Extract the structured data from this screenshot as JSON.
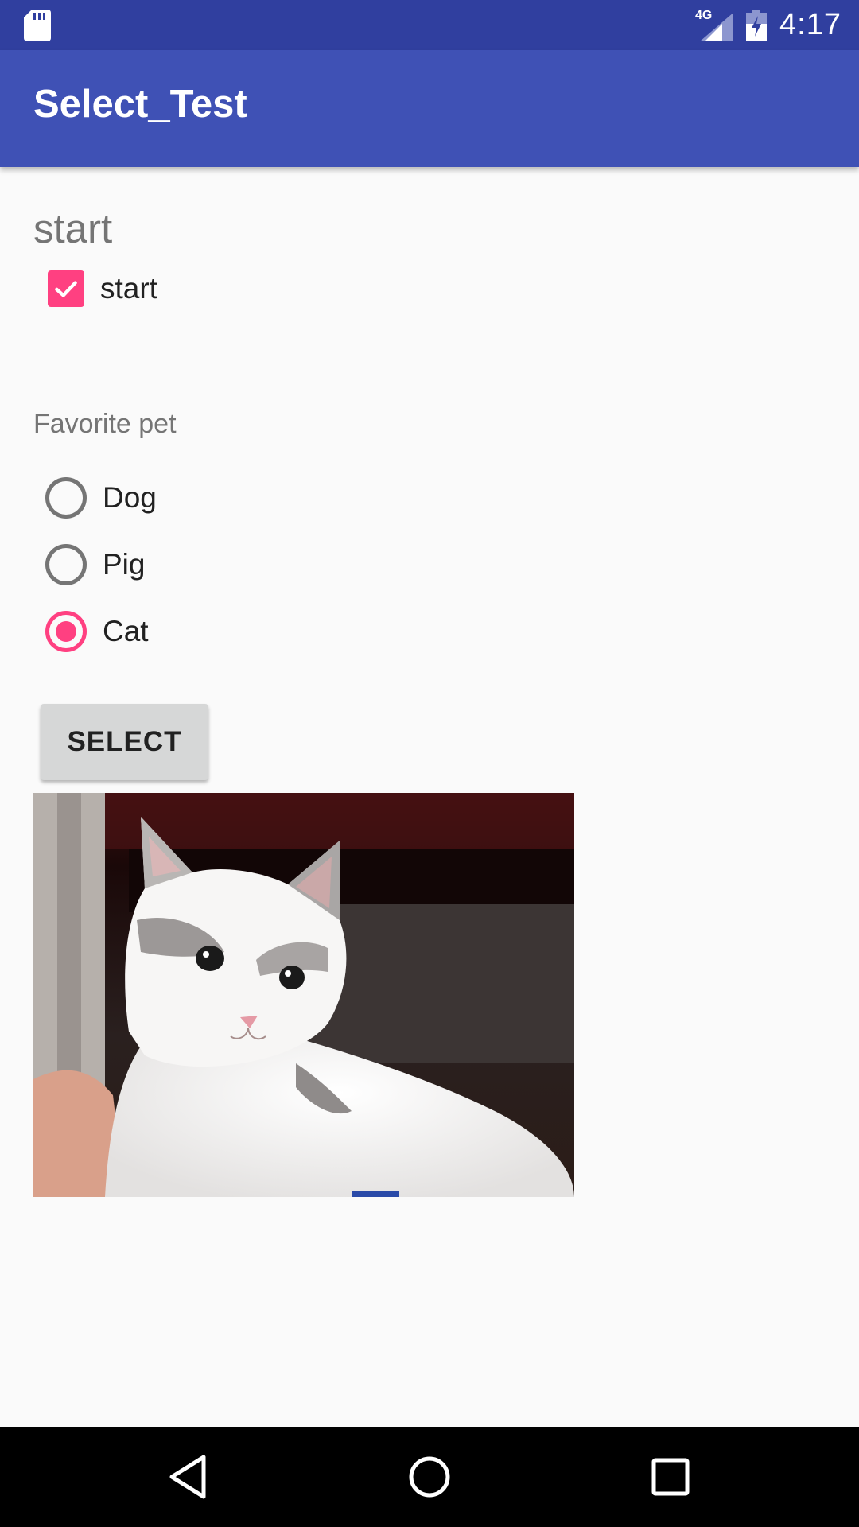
{
  "status_bar": {
    "network_type": "4G",
    "time": "4:17",
    "icons": [
      "sd-card-icon",
      "signal-icon",
      "battery-charging-icon"
    ]
  },
  "app_bar": {
    "title": "Select_Test"
  },
  "main": {
    "heading": "start",
    "checkbox": {
      "label": "start",
      "checked": true
    },
    "radio_group": {
      "label": "Favorite pet",
      "options": [
        {
          "label": "Dog",
          "checked": false
        },
        {
          "label": "Pig",
          "checked": false
        },
        {
          "label": "Cat",
          "checked": true
        }
      ]
    },
    "select_button_label": "SELECT",
    "image": {
      "subject": "cat"
    }
  },
  "nav_bar": {
    "icons": [
      "back-icon",
      "home-icon",
      "recents-icon"
    ]
  },
  "colors": {
    "status_bar": "#303f9f",
    "app_bar": "#3f51b5",
    "accent": "#ff4081",
    "background": "#fafafa"
  }
}
